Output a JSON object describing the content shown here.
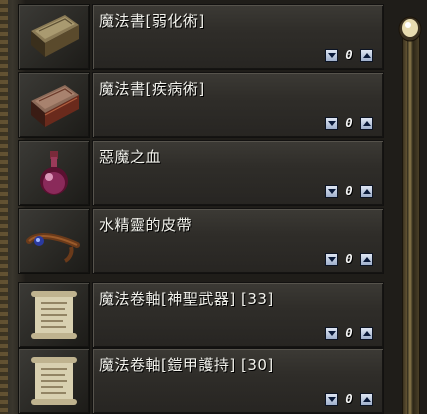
{
  "inventory": {
    "items": [
      {
        "name": "魔法書[弱化術]",
        "quantity": "0",
        "icon": "spellbook-brown-icon"
      },
      {
        "name": "魔法書[疾病術]",
        "quantity": "0",
        "icon": "spellbook-red-icon"
      },
      {
        "name": "惡魔之血",
        "quantity": "0",
        "icon": "potion-red-bottle-icon"
      },
      {
        "name": "水精靈的皮帶",
        "quantity": "0",
        "icon": "leather-belt-blue-gem-icon"
      },
      {
        "name": "魔法卷軸[神聖武器] [33]",
        "quantity": "0",
        "icon": "scroll-icon"
      },
      {
        "name": "魔法卷軸[鎧甲護持] [30]",
        "quantity": "0",
        "icon": "scroll-icon"
      }
    ]
  },
  "colors": {
    "text": "#f2f2ec",
    "button": "#9fb0cc",
    "frame": "#6a5a37"
  }
}
